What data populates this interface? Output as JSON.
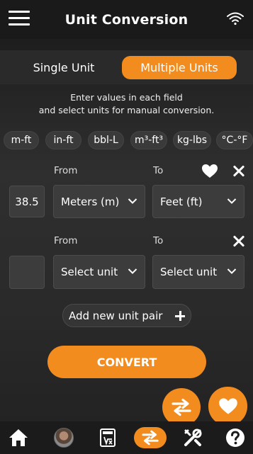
{
  "header": {
    "title": "Unit Conversion"
  },
  "mode": {
    "single_label": "Single Unit",
    "multiple_label": "Multiple Units",
    "active": "multiple"
  },
  "instructions": {
    "line1": "Enter values in each field",
    "line2": "and select units for manual conversion."
  },
  "presets": [
    "m-ft",
    "in-ft",
    "bbl-L",
    "m³-ft³",
    "kg-lbs",
    "°C-°F"
  ],
  "pairs": [
    {
      "from_label": "From",
      "to_label": "To",
      "value": "38.5",
      "from_unit": "Meters (m)",
      "to_unit": "Feet (ft)",
      "favorite": true
    },
    {
      "from_label": "From",
      "to_label": "To",
      "value": "",
      "from_unit": "Select unit",
      "to_unit": "Select unit",
      "favorite": false
    }
  ],
  "add_pair_label": "Add new unit pair",
  "convert_label": "CONVERT",
  "colors": {
    "accent": "#f28c1e",
    "background": "#2a2a2a",
    "field": "#3c3c3c"
  },
  "nav": {
    "items": [
      "home-icon",
      "avatar",
      "calculator-icon",
      "swap-icon",
      "tools-icon",
      "help-icon"
    ],
    "active": "swap-icon"
  }
}
